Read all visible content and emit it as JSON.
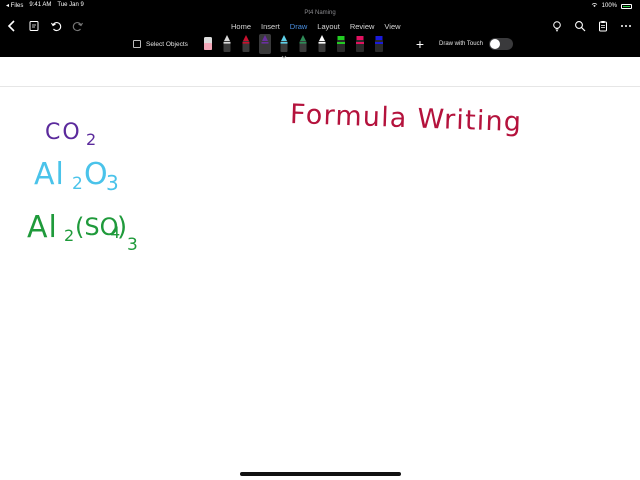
{
  "status_bar": {
    "back_app": "◂ Files",
    "time": "9:41 AM",
    "date": "Tue Jan 9",
    "battery": "100%"
  },
  "document": {
    "title": "Pt4 Naming"
  },
  "ribbon": {
    "tabs": [
      {
        "label": "Home",
        "active": false
      },
      {
        "label": "Insert",
        "active": false
      },
      {
        "label": "Draw",
        "active": true
      },
      {
        "label": "Layout",
        "active": false
      },
      {
        "label": "Review",
        "active": false
      },
      {
        "label": "View",
        "active": false
      }
    ]
  },
  "draw_toolbar": {
    "select_objects_label": "Select Objects",
    "draw_with_touch_label": "Draw with Touch",
    "draw_with_touch_on": false,
    "pens": [
      {
        "kind": "eraser",
        "color": "#f2a7b8"
      },
      {
        "kind": "pen",
        "color": "#d9d9d9"
      },
      {
        "kind": "pen",
        "color": "#c8102e"
      },
      {
        "kind": "pen",
        "color": "#6a2fa0",
        "selected": true
      },
      {
        "kind": "pen",
        "color": "#5ecfe8"
      },
      {
        "kind": "pen",
        "color": "#2e8b57"
      },
      {
        "kind": "pen",
        "color": "#ffffff"
      },
      {
        "kind": "highlighter",
        "color": "#22cc22"
      },
      {
        "kind": "highlighter",
        "color": "#e0115f"
      },
      {
        "kind": "highlighter",
        "color": "#1a1adb"
      }
    ]
  },
  "ink_colors": {
    "title": "#b4123c",
    "co2": "#5b2a9c",
    "al2o3": "#4ac3ea",
    "al2so43": "#1f9a3b"
  },
  "canvas": {
    "heading": "Formula Writing",
    "formulas": [
      {
        "main": "CO",
        "sub": "2"
      },
      {
        "main": "Al",
        "sub": "2",
        "main2": "O",
        "sub2": "3"
      },
      {
        "main": "Al",
        "sub": "2",
        "main2": "(SO",
        "sub2": "4",
        "main3": ")",
        "sub3": "3"
      }
    ]
  }
}
